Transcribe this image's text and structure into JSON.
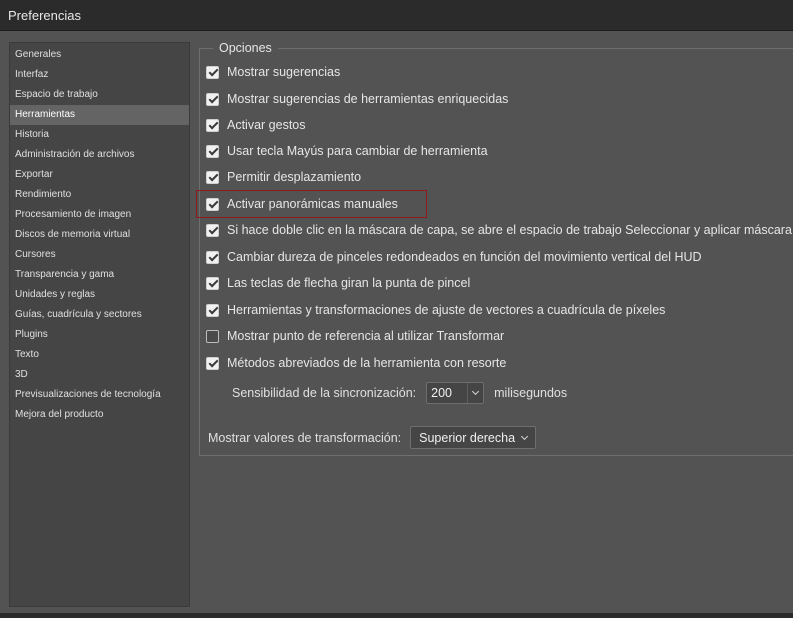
{
  "window": {
    "title": "Preferencias"
  },
  "sidebar": {
    "items": [
      {
        "label": "Generales",
        "active": false
      },
      {
        "label": "Interfaz",
        "active": false
      },
      {
        "label": "Espacio de trabajo",
        "active": false
      },
      {
        "label": "Herramientas",
        "active": true
      },
      {
        "label": "Historia",
        "active": false
      },
      {
        "label": "Administración de archivos",
        "active": false
      },
      {
        "label": "Exportar",
        "active": false
      },
      {
        "label": "Rendimiento",
        "active": false
      },
      {
        "label": "Procesamiento de imagen",
        "active": false
      },
      {
        "label": "Discos de memoria virtual",
        "active": false
      },
      {
        "label": "Cursores",
        "active": false
      },
      {
        "label": "Transparencia y gama",
        "active": false
      },
      {
        "label": "Unidades y reglas",
        "active": false
      },
      {
        "label": "Guías, cuadrícula y sectores",
        "active": false
      },
      {
        "label": "Plugins",
        "active": false
      },
      {
        "label": "Texto",
        "active": false
      },
      {
        "label": "3D",
        "active": false
      },
      {
        "label": "Previsualizaciones de tecnología",
        "active": false
      },
      {
        "label": "Mejora del producto",
        "active": false
      }
    ]
  },
  "options": {
    "legend": "Opciones",
    "items": [
      {
        "label": "Mostrar sugerencias",
        "checked": true
      },
      {
        "label": "Mostrar sugerencias de herramientas enriquecidas",
        "checked": true
      },
      {
        "label": "Activar gestos",
        "checked": true
      },
      {
        "label": "Usar tecla Mayús para cambiar de herramienta",
        "checked": true
      },
      {
        "label": "Permitir desplazamiento",
        "checked": true
      },
      {
        "label": "Activar panorámicas manuales",
        "checked": true,
        "highlighted": true
      },
      {
        "label": "Si hace doble clic en la máscara de capa, se abre el espacio de trabajo Seleccionar y aplicar máscara",
        "checked": true
      },
      {
        "label": "Cambiar dureza de pinceles redondeados en función del movimiento vertical del HUD",
        "checked": true
      },
      {
        "label": "Las teclas de flecha giran la punta de pincel",
        "checked": true
      },
      {
        "label": "Herramientas y transformaciones de ajuste de vectores a cuadrícula de píxeles",
        "checked": true
      },
      {
        "label": "Mostrar punto de referencia al utilizar Transformar",
        "checked": false
      },
      {
        "label": "Métodos abreviados de la herramienta con resorte",
        "checked": true
      }
    ],
    "sensitivity": {
      "label": "Sensibilidad de la sincronización:",
      "value": "200",
      "unit": "milisegundos"
    },
    "transform_values": {
      "label": "Mostrar valores de transformación:",
      "value": "Superior derecha"
    }
  },
  "colors": {
    "background": "#535353",
    "titlebar": "#2b2b2b",
    "sidebar": "#454545",
    "sidebar_active": "#646464",
    "highlight_border": "#8e1a1a"
  }
}
